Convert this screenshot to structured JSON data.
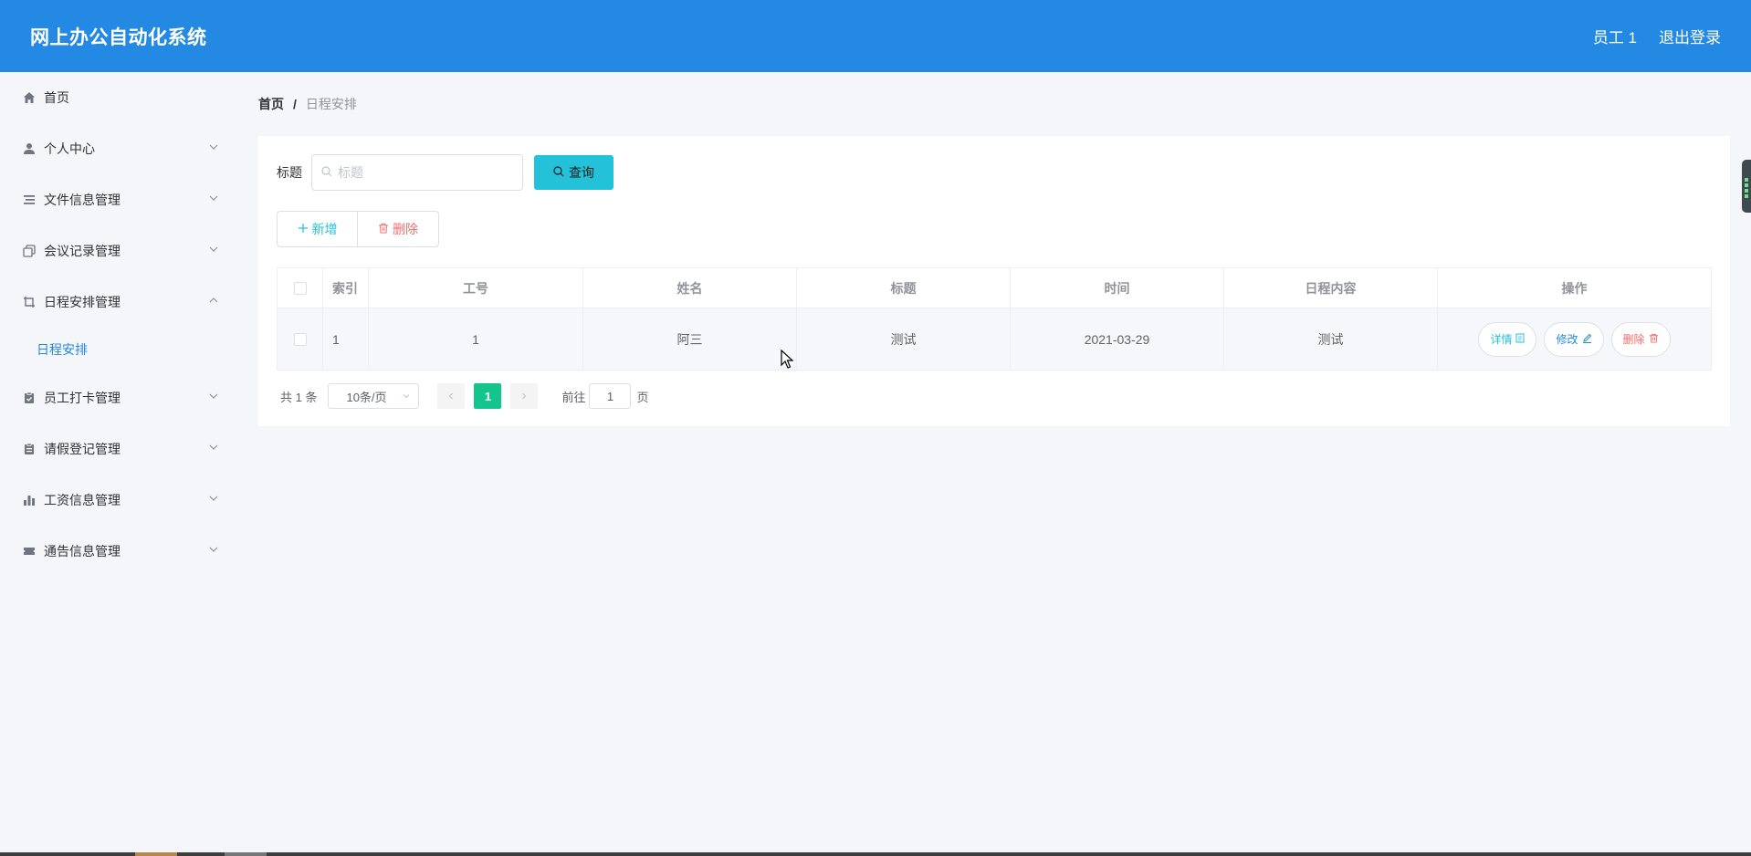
{
  "header": {
    "app_title": "网上办公自动化系统",
    "user_label": "员工 1",
    "logout_label": "退出登录"
  },
  "sidebar": {
    "items": [
      {
        "label": "首页",
        "icon": "home-icon"
      },
      {
        "label": "个人中心",
        "icon": "user-icon"
      },
      {
        "label": "文件信息管理",
        "icon": "list-icon"
      },
      {
        "label": "会议记录管理",
        "icon": "copy-icon"
      },
      {
        "label": "日程安排管理",
        "icon": "crop-icon",
        "expanded": true
      },
      {
        "label": "员工打卡管理",
        "icon": "clipboard-check-icon"
      },
      {
        "label": "请假登记管理",
        "icon": "clipboard-icon"
      },
      {
        "label": "工资信息管理",
        "icon": "bar-chart-icon"
      },
      {
        "label": "通告信息管理",
        "icon": "ticket-icon"
      }
    ],
    "submenu": {
      "label": "日程安排"
    }
  },
  "breadcrumb": {
    "home": "首页",
    "separator": "/",
    "current": "日程安排"
  },
  "search": {
    "label": "标题",
    "placeholder": "标题",
    "query_label": "查询"
  },
  "actions": {
    "add_label": "新增",
    "delete_label": "删除"
  },
  "table": {
    "columns": [
      "索引",
      "工号",
      "姓名",
      "标题",
      "时间",
      "日程内容",
      "操作"
    ],
    "rows": [
      {
        "index": "1",
        "gonghao": "1",
        "name": "阿三",
        "title": "测试",
        "time": "2021-03-29",
        "content": "测试"
      }
    ],
    "op_detail": "详情",
    "op_edit": "修改",
    "op_delete": "删除"
  },
  "pagination": {
    "total": "共 1 条",
    "page_size": "10条/页",
    "current_page": "1",
    "goto_label": "前往",
    "goto_value": "1",
    "page_suffix": "页"
  },
  "colors": {
    "header_bg": "#2389e2",
    "query_btn": "#23c2d9",
    "active_page": "#13c58d",
    "danger": "#f56c6c"
  }
}
